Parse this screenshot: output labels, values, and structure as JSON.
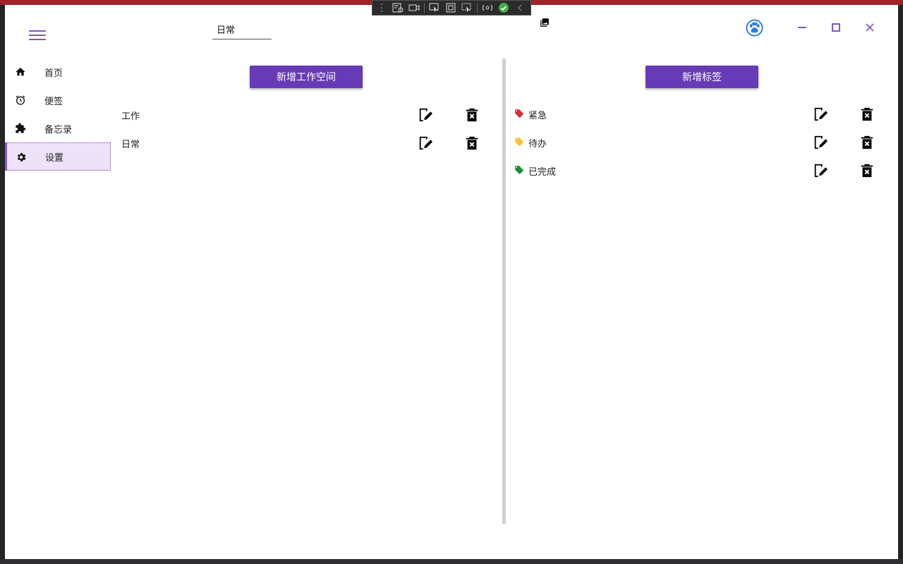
{
  "toolbar": {
    "workspace_value": "日常"
  },
  "sidebar": {
    "items": [
      {
        "label": "首页",
        "icon": "home-icon"
      },
      {
        "label": "便签",
        "icon": "alarm-icon"
      },
      {
        "label": "备忘录",
        "icon": "puzzle-icon"
      },
      {
        "label": "设置",
        "icon": "gear-icon",
        "active": true
      }
    ]
  },
  "workspaces": {
    "add_label": "新增工作空间",
    "items": [
      {
        "name": "工作"
      },
      {
        "name": "日常"
      }
    ]
  },
  "tags": {
    "add_label": "新增标签",
    "items": [
      {
        "name": "紧急",
        "color": "#d32f2f"
      },
      {
        "name": "待办",
        "color": "#fbc02d"
      },
      {
        "name": "已完成",
        "color": "#1e8e3e"
      }
    ]
  },
  "colors": {
    "accent": "#673ab7",
    "title_strip": "#a1232a",
    "nav_active_bg": "#ede2f8"
  }
}
